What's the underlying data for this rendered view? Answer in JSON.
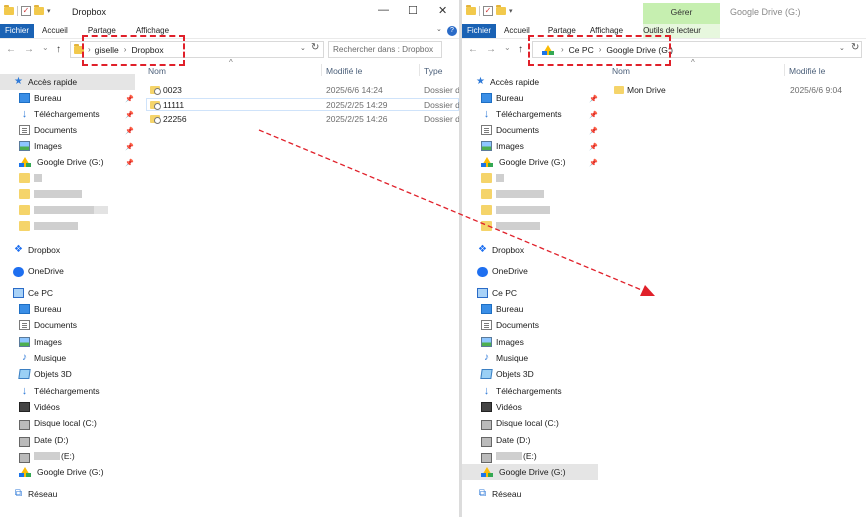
{
  "left": {
    "quick_access": {
      "check": "✓",
      "dropdown": "▾"
    },
    "title": "Dropbox",
    "window_controls": {
      "minimize": "—",
      "maximize": "☐",
      "close": "✕"
    },
    "ribbon_tabs": [
      "Fichier",
      "Accueil",
      "Partage",
      "Affichage"
    ],
    "help": "?",
    "nav_buttons": {
      "back": "←",
      "forward": "→",
      "recent": "⌄",
      "up": "↑"
    },
    "breadcrumb": [
      "giselle",
      "Dropbox"
    ],
    "breadcrumb_separator": "›",
    "address_dropdown": "⌄",
    "refresh": "↻",
    "search_placeholder": "Rechercher dans : Dropbox",
    "columns": {
      "name": "Nom",
      "modified": "Modifié le",
      "type": "Type"
    },
    "sort_indicator": "^",
    "files": [
      {
        "name": "0023",
        "modified": "2025/6/6 14:24",
        "type": "Dossier de"
      },
      {
        "name": "11111",
        "modified": "2025/2/25 14:29",
        "type": "Dossier de"
      },
      {
        "name": "22256",
        "modified": "2025/2/25 14:26",
        "type": "Dossier de"
      }
    ]
  },
  "right": {
    "quick_access": {
      "check": "✓",
      "dropdown": "▾"
    },
    "context_group": "Gérer",
    "title": "Google Drive (G:)",
    "ribbon_tabs": [
      "Fichier",
      "Accueil",
      "Partage",
      "Affichage",
      "Outils de lecteur"
    ],
    "nav_buttons": {
      "back": "←",
      "forward": "→",
      "recent": "⌄",
      "up": "↑"
    },
    "breadcrumb": [
      "Ce PC",
      "Google Drive (G:)"
    ],
    "breadcrumb_separator": "›",
    "address_dropdown": "⌄",
    "refresh": "↻",
    "columns": {
      "name": "Nom",
      "modified": "Modifié le"
    },
    "sort_indicator": "^",
    "files": [
      {
        "name": "Mon Drive",
        "modified": "2025/6/6 9:04"
      }
    ]
  },
  "nav_glyphs": {
    "pin": "📌",
    "star": "★",
    "download": "↓",
    "dropbox": "❖",
    "music": "♪",
    "network": "⧉"
  },
  "nav": {
    "quick_access": "Accès rapide",
    "pinned": [
      "Bureau",
      "Téléchargements",
      "Documents",
      "Images",
      "Google Drive (G:)"
    ],
    "dropbox": "Dropbox",
    "onedrive": "OneDrive",
    "this_pc": "Ce PC",
    "pc_items": [
      "Bureau",
      "Documents",
      "Images",
      "Musique",
      "Objets 3D",
      "Téléchargements",
      "Vidéos",
      "Disque local (C:)",
      "Date (D:)",
      "(E:)",
      "Google Drive (G:)"
    ],
    "network": "Réseau"
  },
  "colors": {
    "file_tab": "#1a62b4",
    "context_tab": "#c6efb0",
    "highlight": "#e0202a",
    "selection": "#e5e5e5"
  }
}
